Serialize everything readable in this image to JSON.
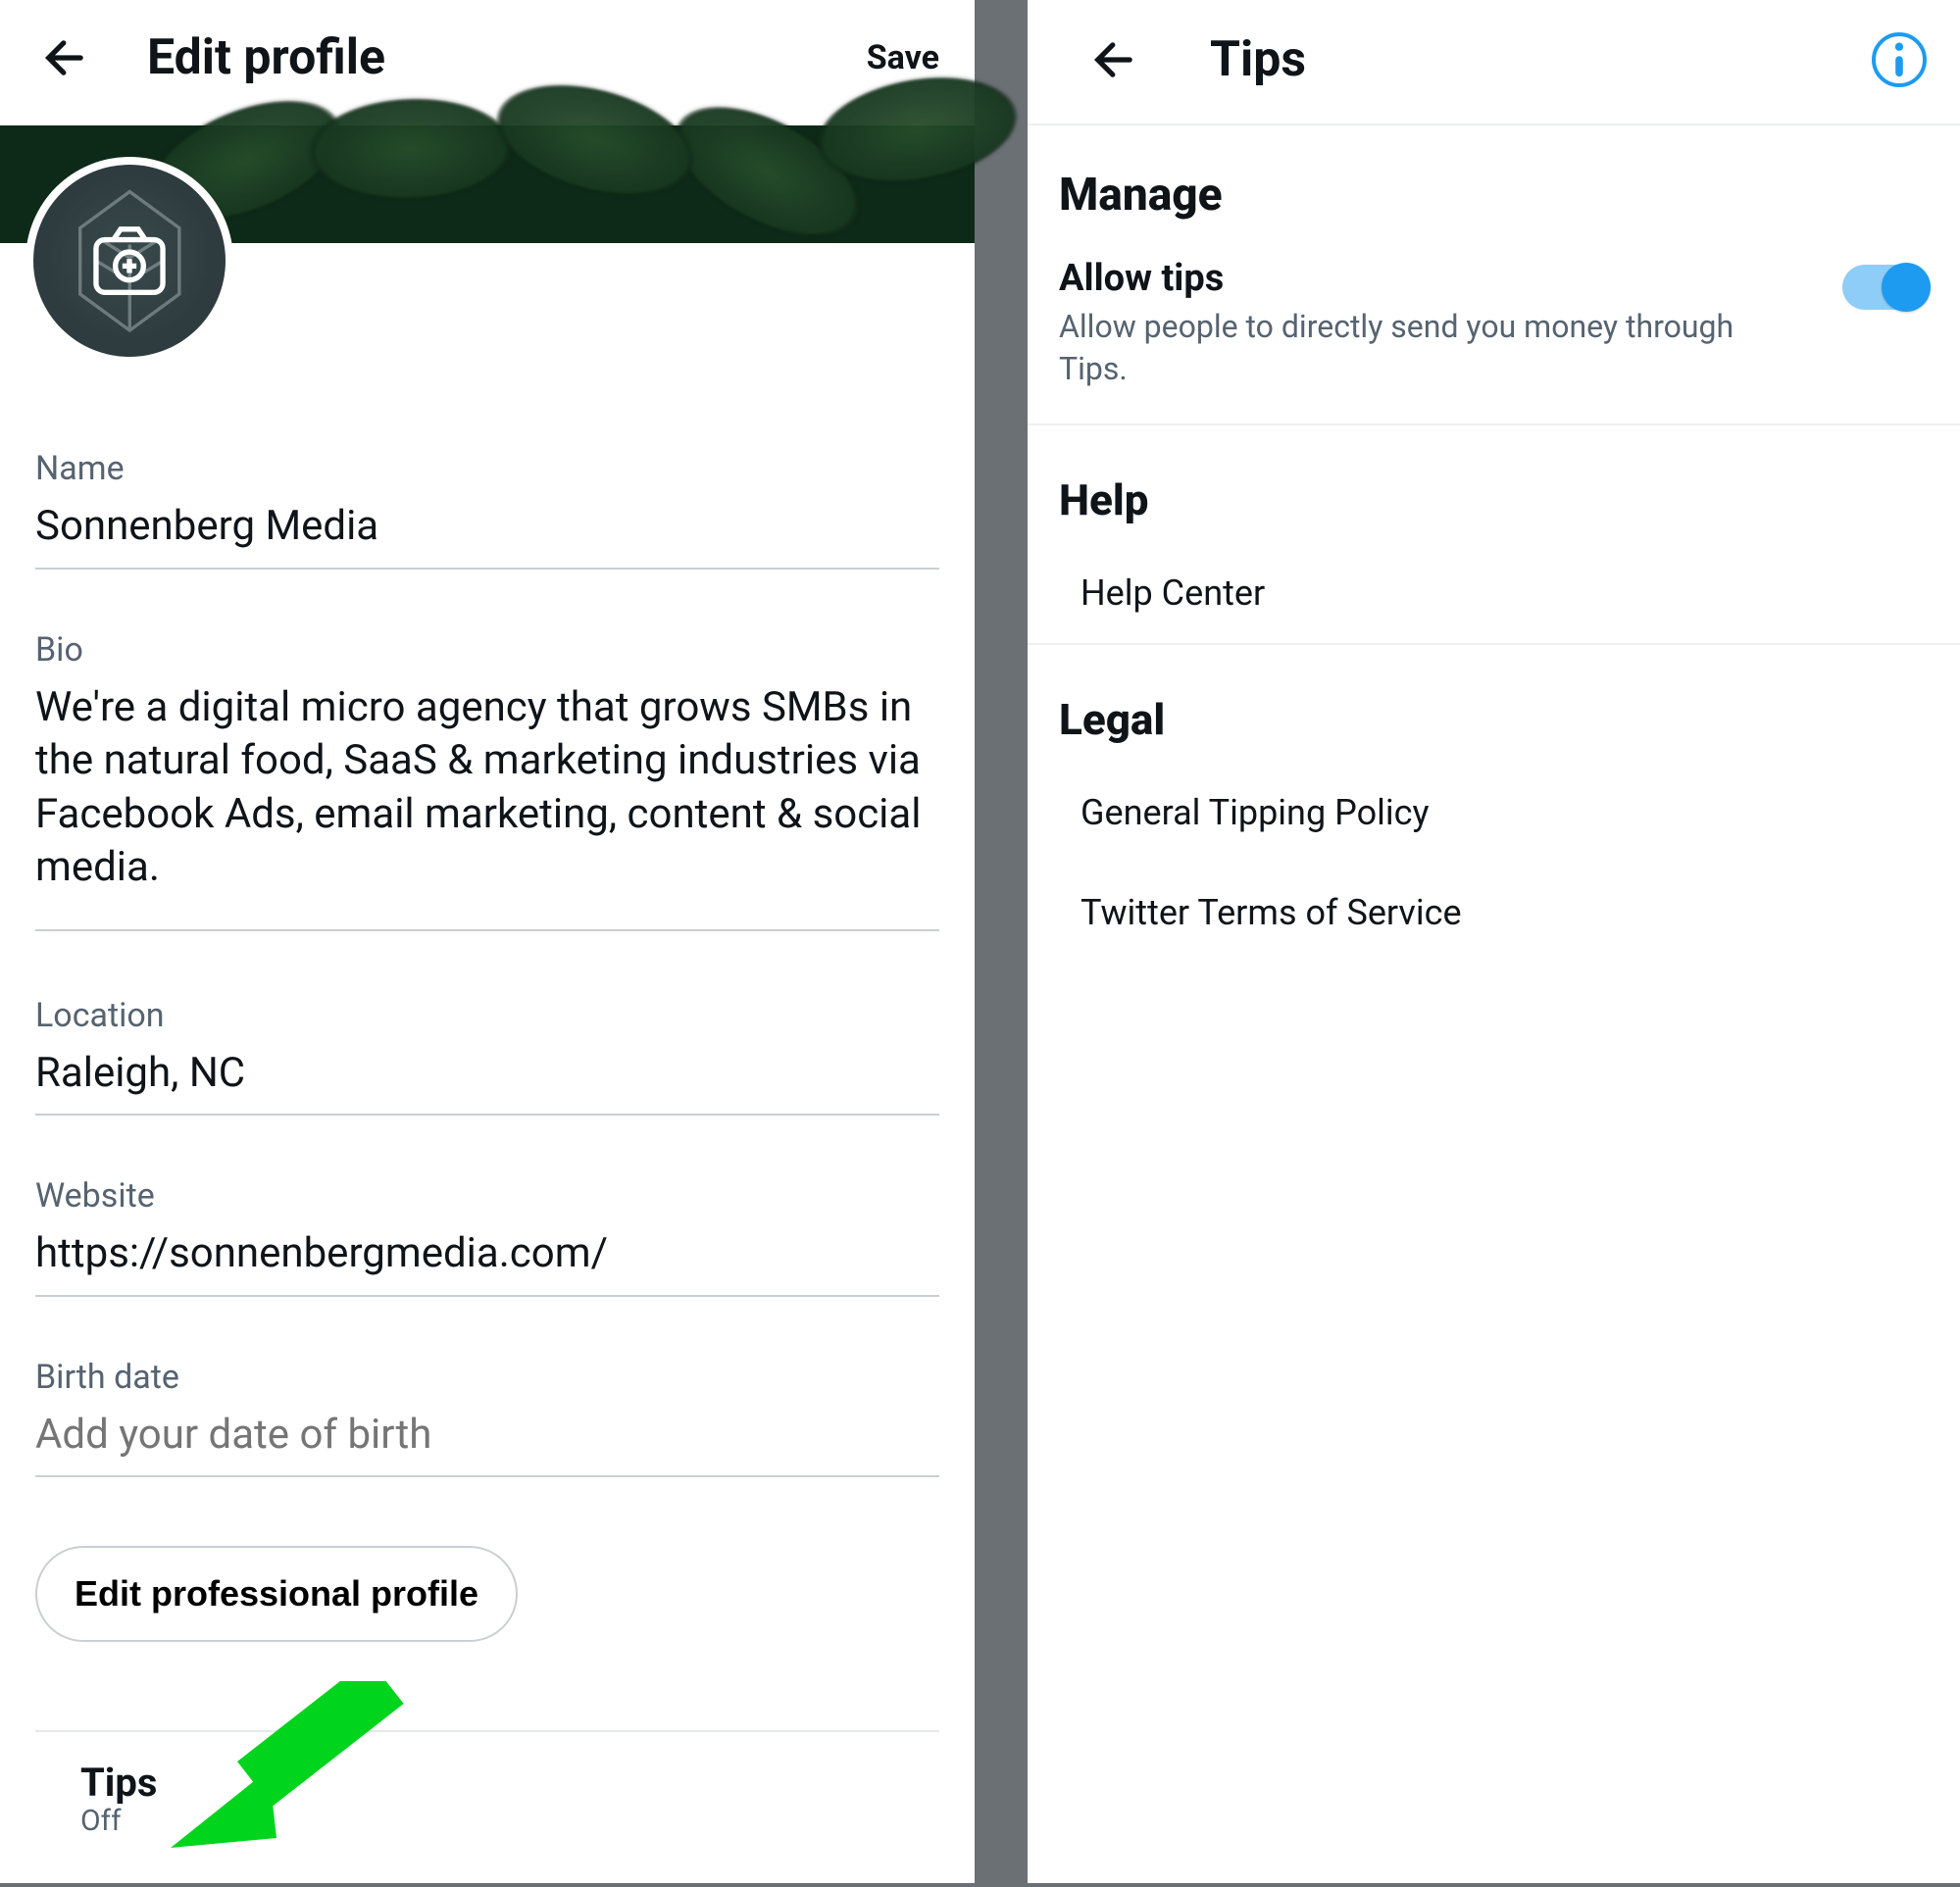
{
  "left": {
    "header": {
      "title": "Edit profile",
      "save_label": "Save"
    },
    "fields": {
      "name_label": "Name",
      "name_value": "Sonnenberg Media",
      "bio_label": "Bio",
      "bio_value": "We're a digital micro agency that grows SMBs in the natural food, SaaS & marketing industries via Facebook Ads, email marketing, content & social media.",
      "location_label": "Location",
      "location_value": "Raleigh, NC",
      "website_label": "Website",
      "website_value": "https://sonnenbergmedia.com/",
      "birth_label": "Birth date",
      "birth_placeholder": "Add your date of birth"
    },
    "edit_professional_label": "Edit professional profile",
    "tips": {
      "title": "Tips",
      "status": "Off"
    }
  },
  "right": {
    "header": {
      "title": "Tips"
    },
    "manage": {
      "heading": "Manage",
      "allow_title": "Allow tips",
      "allow_desc": "Allow people to directly send you money through Tips.",
      "allow_enabled": true
    },
    "help": {
      "heading": "Help",
      "links": [
        "Help Center"
      ]
    },
    "legal": {
      "heading": "Legal",
      "links": [
        "General Tipping Policy",
        "Twitter Terms of Service"
      ]
    }
  },
  "colors": {
    "accent": "#1d9bf0",
    "annotation": "#00d41c"
  }
}
